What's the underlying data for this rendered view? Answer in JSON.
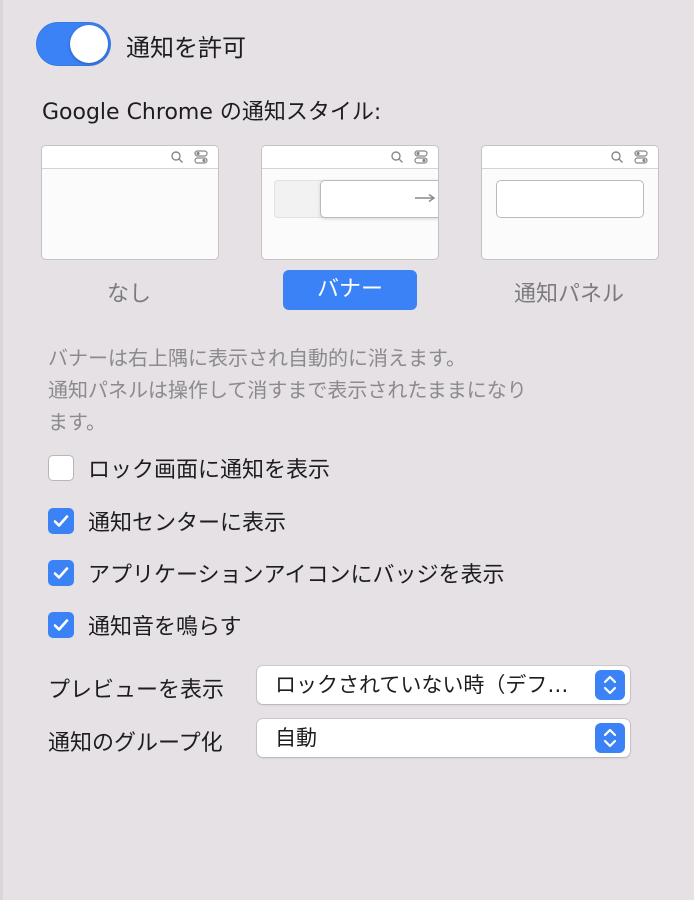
{
  "notifications": {
    "allow_label": "通知を許可",
    "allow_enabled": true
  },
  "style_section": {
    "title": "Google Chrome の通知スタイル:",
    "options": [
      {
        "label": "なし",
        "selected": false
      },
      {
        "label": "バナー",
        "selected": true
      },
      {
        "label": "通知パネル",
        "selected": false
      }
    ],
    "description_line1": "バナーは右上隅に表示され自動的に消えます。",
    "description_line2": "通知パネルは操作して消すまで表示されたままになり",
    "description_line3": "ます。"
  },
  "checkboxes": [
    {
      "label": "ロック画面に通知を表示",
      "checked": false
    },
    {
      "label": "通知センターに表示",
      "checked": true
    },
    {
      "label": "アプリケーションアイコンにバッジを表示",
      "checked": true
    },
    {
      "label": "通知音を鳴らす",
      "checked": true
    }
  ],
  "selects": {
    "preview": {
      "label": "プレビューを表示",
      "value": "ロックされていない時（デフ…"
    },
    "grouping": {
      "label": "通知のグループ化",
      "value": "自動"
    }
  },
  "colors": {
    "accent": "#3b82f7",
    "background": "#e5e1e4",
    "secondary_text": "#8c8a8d"
  },
  "icons": {
    "search": "magnifier-icon",
    "toggles": "switches-icon",
    "arrow": "right-arrow-icon",
    "check": "checkmark-icon",
    "stepper": "up-down-chevron-icon"
  }
}
